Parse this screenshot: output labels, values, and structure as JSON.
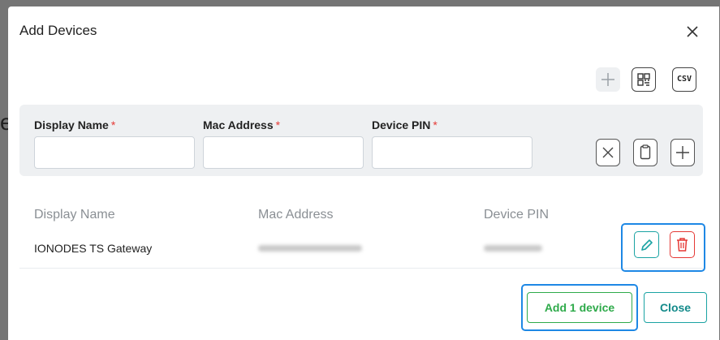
{
  "background": {
    "partial_glyph": "e"
  },
  "dialog": {
    "title": "Add Devices",
    "close_icon": "close-icon",
    "toolbar": {
      "add_icon": "plus-icon",
      "qr_icon": "qr-code-icon",
      "csv_label": "CSV"
    }
  },
  "form": {
    "fields": [
      {
        "label": "Display Name",
        "required_mark": "*",
        "value": ""
      },
      {
        "label": "Mac Address",
        "required_mark": "*",
        "value": ""
      },
      {
        "label": "Device PIN",
        "required_mark": "*",
        "value": ""
      }
    ],
    "actions": [
      "clear-icon",
      "clipboard-icon",
      "plus-icon"
    ]
  },
  "table": {
    "headers": [
      "Display Name",
      "Mac Address",
      "Device PIN"
    ],
    "rows": [
      {
        "display_name": "IONODES TS Gateway",
        "mac_address": "(blurred)",
        "device_pin": "(blurred)"
      }
    ],
    "row_actions": [
      "edit-icon",
      "delete-icon"
    ]
  },
  "footer": {
    "add_label": "Add 1 device",
    "close_label": "Close"
  },
  "colors": {
    "accent_teal": "#1aa3a3",
    "success_green": "#2eaa4a",
    "danger_red": "#e53935",
    "highlight_blue": "#1e88e5"
  }
}
